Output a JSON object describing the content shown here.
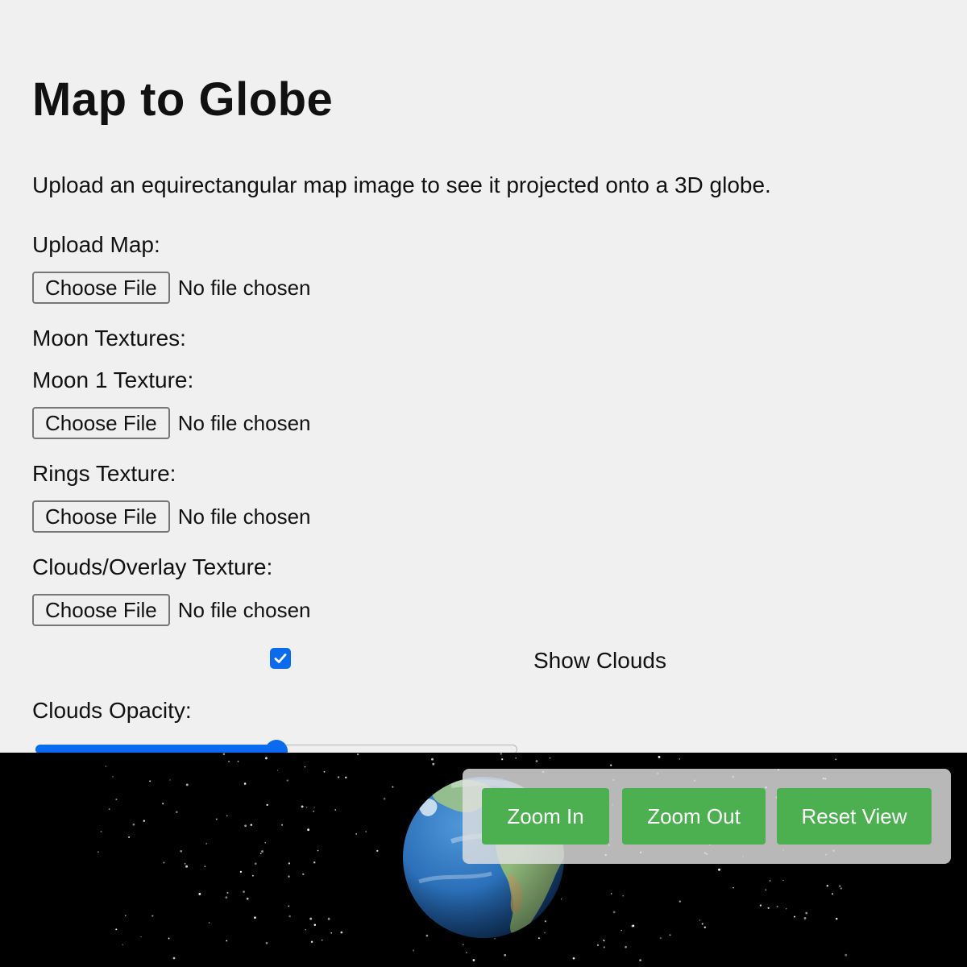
{
  "title": "Map to Globe",
  "description": "Upload an equirectangular map image to see it projected onto a 3D globe.",
  "upload_map": {
    "label": "Upload Map:",
    "button": "Choose File",
    "status": "No file chosen"
  },
  "moon_textures": {
    "label": "Moon Textures:",
    "moon1_label": "Moon 1 Texture:",
    "button": "Choose File",
    "status": "No file chosen"
  },
  "rings_texture": {
    "label": "Rings Texture:",
    "button": "Choose File",
    "status": "No file chosen"
  },
  "clouds_texture": {
    "label": "Clouds/Overlay Texture:",
    "button": "Choose File",
    "status": "No file chosen"
  },
  "show_clouds": {
    "label": "Show Clouds",
    "checked": true
  },
  "clouds_opacity": {
    "label": "Clouds Opacity:",
    "value": 0.5
  },
  "controls": {
    "zoom_in": "Zoom In",
    "zoom_out": "Zoom Out",
    "reset_view": "Reset View"
  },
  "colors": {
    "accent": "#0b6bf0",
    "button_green": "#4caf50",
    "viewer_bg": "#000000",
    "ocean": "#2a6fb8",
    "land": "#8fb87a"
  }
}
